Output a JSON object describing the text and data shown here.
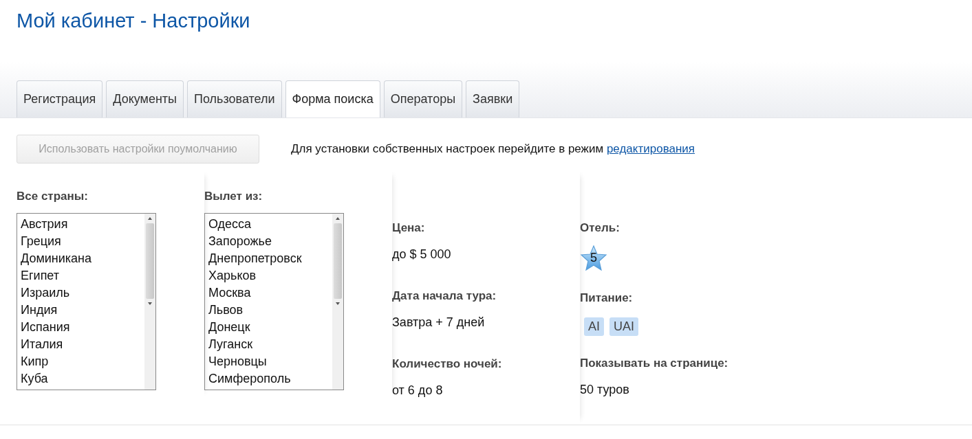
{
  "title": "Мой кабинет - Настройки",
  "tabs": [
    {
      "label": "Регистрация",
      "selected": false
    },
    {
      "label": "Документы",
      "selected": false
    },
    {
      "label": "Пользователи",
      "selected": false
    },
    {
      "label": "Форма поиска",
      "selected": true
    },
    {
      "label": "Операторы",
      "selected": false
    },
    {
      "label": "Заявки",
      "selected": false
    }
  ],
  "default_button": {
    "label": "Использовать настройки поумолчанию",
    "disabled": true
  },
  "notice": {
    "text": "Для установки собственных настроек перейдите в режим",
    "link": "редактирования"
  },
  "lists": [
    {
      "label": "Все страны:",
      "items": [
        "Австрия",
        "Греция",
        "Доминикана",
        "Египет",
        "Израиль",
        "Индия",
        "Испания",
        "Италия",
        "Кипр",
        "Куба"
      ]
    },
    {
      "label": "Вылет из:",
      "items": [
        "Одесса",
        "Запорожье",
        "Днепропетровск",
        "Харьков",
        "Москва",
        "Львов",
        "Донецк",
        "Луганск",
        "Черновцы",
        "Симферополь"
      ]
    }
  ],
  "params": [
    {
      "label": "Цена:",
      "value": "до $ 5 000"
    },
    {
      "label": "Дата начала тура:",
      "value": "Завтра + 7 дней"
    },
    {
      "label": "Количество ночей:",
      "value": "от 6 до 8"
    }
  ],
  "hotel": {
    "label": "Отель:",
    "category": "5"
  },
  "meals": {
    "label": "Питание:",
    "tags": [
      "AI",
      "UAI"
    ]
  },
  "per_page": {
    "label": "Показывать на странице:",
    "value": "50 туров"
  }
}
